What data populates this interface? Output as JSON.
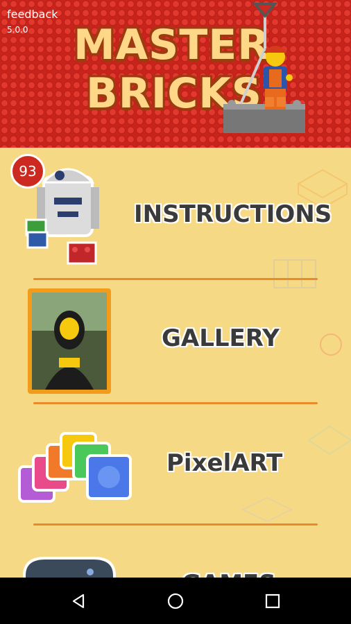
{
  "header": {
    "feedback_label": "feedback",
    "version": "5.0.0",
    "logo_line1": "MASTER",
    "logo_line2": "BRICKS"
  },
  "menu": {
    "items": [
      {
        "label": "INSTRUCTIONS",
        "icon": "robot-icon",
        "badge": "93"
      },
      {
        "label": "GALLERY",
        "icon": "mona-lisa-icon"
      },
      {
        "label": "PixelART",
        "icon": "color-bricks-icon"
      },
      {
        "label": "GAMES",
        "icon": "gamepad-icon"
      }
    ]
  },
  "navbar": {
    "back": "back-icon",
    "home": "home-icon",
    "recents": "recents-icon"
  },
  "colors": {
    "header_red": "#c8241c",
    "background": "#f6d985",
    "divider": "#e98a2b",
    "badge": "#cc2a20"
  }
}
